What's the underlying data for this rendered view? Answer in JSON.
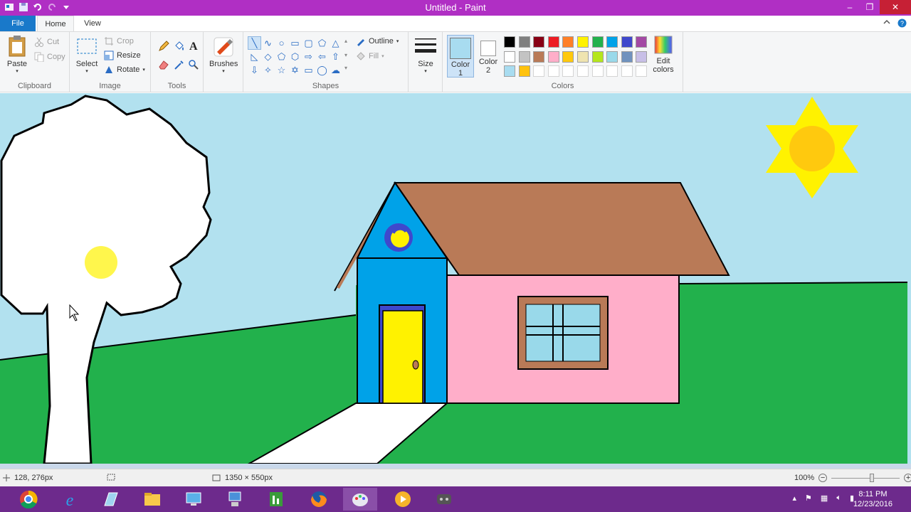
{
  "window": {
    "title": "Untitled - Paint",
    "minimize": "–",
    "restore": "❐",
    "close": "✕"
  },
  "tabs": {
    "file": "File",
    "home": "Home",
    "view": "View"
  },
  "ribbon": {
    "clipboard": {
      "label": "Clipboard",
      "paste": "Paste",
      "cut": "Cut",
      "copy": "Copy"
    },
    "image": {
      "label": "Image",
      "select": "Select",
      "crop": "Crop",
      "resize": "Resize",
      "rotate": "Rotate"
    },
    "tools": {
      "label": "Tools"
    },
    "brushes": {
      "label": "Brushes"
    },
    "shapes": {
      "label": "Shapes",
      "outline": "Outline",
      "fill": "Fill"
    },
    "size": {
      "label": "Size"
    },
    "colors": {
      "label": "Colors",
      "color1": "Color\n1",
      "color1_a": "Color",
      "color1_b": "1",
      "color2_a": "Color",
      "color2_b": "2",
      "edit_a": "Edit",
      "edit_b": "colors",
      "color1_value": "#a8dcf0",
      "color2_value": "#ffffff",
      "palette_row1": [
        "#000000",
        "#7f7f7f",
        "#880015",
        "#ed1c24",
        "#ff7f27",
        "#fff200",
        "#22b14c",
        "#00a2e8",
        "#3f48cc",
        "#a349a4"
      ],
      "palette_row2": [
        "#ffffff",
        "#c3c3c3",
        "#b97a57",
        "#ffaec9",
        "#ffc90e",
        "#efe4b0",
        "#b5e61d",
        "#99d9ea",
        "#7092be",
        "#c8bfe7"
      ],
      "palette_row3": [
        "#a8dcf0",
        "#ffc20e",
        "#ffffff",
        "#ffffff",
        "#ffffff",
        "#ffffff",
        "#ffffff",
        "#ffffff",
        "#ffffff",
        "#ffffff"
      ]
    }
  },
  "drawing": {
    "sky": "#b2e1ef",
    "grass": "#22b14c",
    "tree": "#ffffff",
    "wall": "#ffaec9",
    "roof": "#b97a57",
    "gable": "#00a2e8",
    "door": "#fff200",
    "sun": "#fff200",
    "sun_center": "#ffc90e",
    "window_glass": "#99d9ea"
  },
  "status": {
    "cursor_pos": "128, 276px",
    "canvas_size": "1350 × 550px",
    "zoom": "100%"
  },
  "taskbar": {
    "time": "8:11 PM",
    "date": "12/23/2016"
  }
}
